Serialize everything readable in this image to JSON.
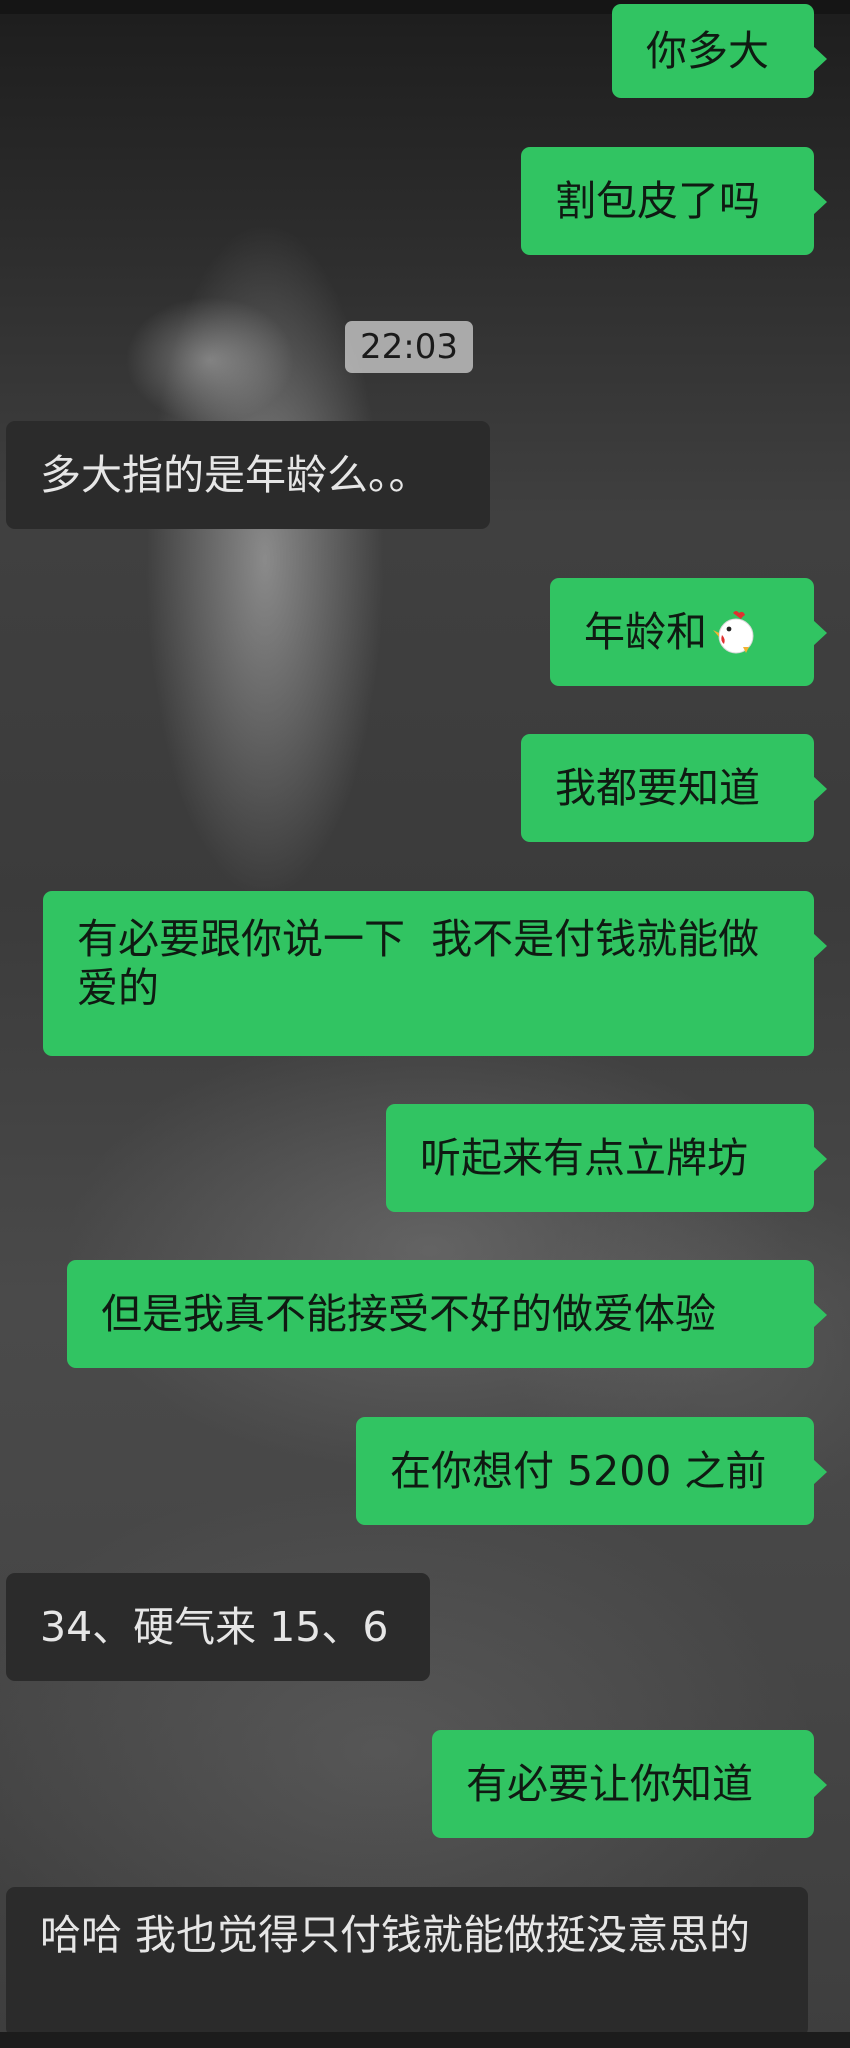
{
  "chat": {
    "timestamp": "22:03",
    "messages": [
      {
        "side": "right",
        "text": "你多大"
      },
      {
        "side": "right",
        "text": "割包皮了吗"
      },
      {
        "side": "left",
        "text": "多大指的是年龄么。。"
      },
      {
        "side": "right",
        "text": "年龄和",
        "emoji": "chicken-emoji"
      },
      {
        "side": "right",
        "text": "我都要知道"
      },
      {
        "side": "right",
        "text": "有必要跟你说一下  我不是付钱就能做爱的"
      },
      {
        "side": "right",
        "text": "听起来有点立牌坊"
      },
      {
        "side": "right",
        "text": "但是我真不能接受不好的做爱体验"
      },
      {
        "side": "right",
        "text": "在你想付 5200 之前"
      },
      {
        "side": "left",
        "text": "34、硬气来 15、6"
      },
      {
        "side": "right",
        "text": "有必要让你知道"
      },
      {
        "side": "left",
        "text": "哈哈 我也觉得只付钱就能做挺没意思的"
      }
    ]
  },
  "colors": {
    "outgoing_bubble": "#31c462",
    "incoming_bubble": "#2b2b2b",
    "timestamp_bg": "#c8c8c8"
  }
}
